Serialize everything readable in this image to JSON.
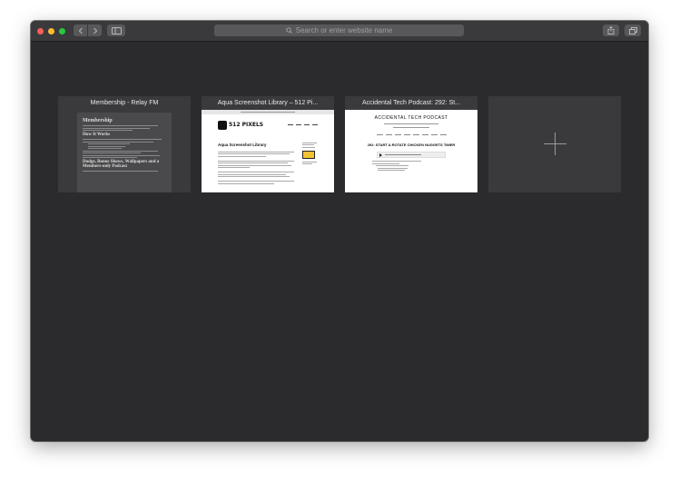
{
  "toolbar": {
    "address_placeholder": "Search or enter website name"
  },
  "tabs": [
    {
      "title": "Membership - Relay FM"
    },
    {
      "title": "Aqua Screenshot Library – 512 Pi..."
    },
    {
      "title": "Accidental Tech Podcast: 292: St..."
    }
  ],
  "previews": {
    "relay": {
      "heading": "Membership",
      "section1": "How It Works",
      "section2": "Dodge, Bonus Shows, Wallpapers and a Members-only Podcast"
    },
    "pixels": {
      "logo": "512 PIXELS",
      "page_title": "Aqua Screenshot Library"
    },
    "atp": {
      "site_title": "ACCIDENTAL TECH PODCAST",
      "episode_title": "292: START A ROTATE CHICKEN NUGGETS TIMER"
    }
  },
  "icons": {
    "back": "chevron-left-icon",
    "forward": "chevron-right-icon",
    "sidebar": "sidebar-icon",
    "search": "search-icon",
    "share": "share-icon",
    "tabs": "tab-overview-icon",
    "new_tab": "plus-icon"
  },
  "colors": {
    "window_bg": "#2b2b2d",
    "toolbar_bg": "#3a3a3c",
    "close": "#fe5f57",
    "minimize": "#febc2e",
    "zoom": "#28c840"
  }
}
